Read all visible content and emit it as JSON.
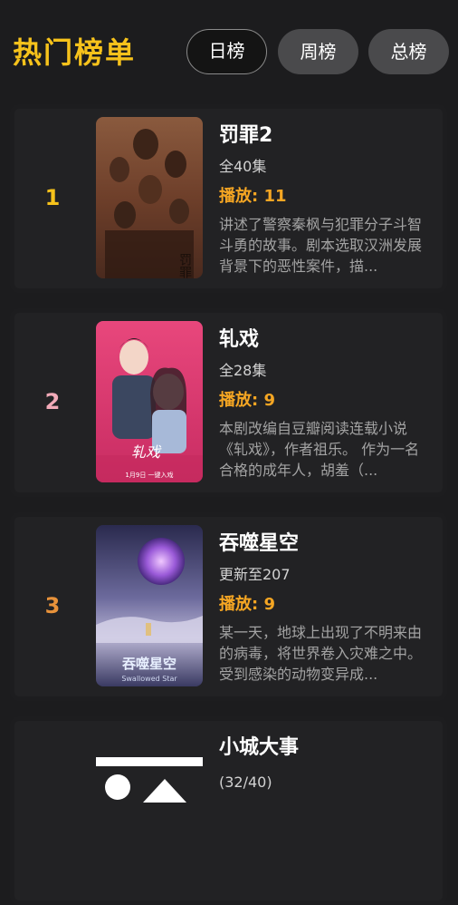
{
  "header": {
    "title": "热门榜单",
    "tabs": [
      {
        "label": "日榜",
        "active": true
      },
      {
        "label": "周榜",
        "active": false
      },
      {
        "label": "总榜",
        "active": false
      }
    ]
  },
  "colors": {
    "title": "#f6c21b",
    "plays": "#f5a623",
    "rank1": "#f6c21b",
    "rank2": "#f2aab8",
    "rank3": "#e8923a"
  },
  "items": [
    {
      "rank": "1",
      "name": "罚罪2",
      "episodes": "全40集",
      "plays": "播放: 11",
      "description": "讲述了警察秦枫与犯罪分子斗智斗勇的故事。剧本选取汉洲发展背景下的恶性案件，描...",
      "poster_text": "罚罪"
    },
    {
      "rank": "2",
      "name": "轧戏",
      "episodes": "全28集",
      "plays": "播放: 9",
      "description": "本剧改编自豆瓣阅读连载小说《轧戏》，作者祖乐。 作为一名合格的成年人，胡羞（...",
      "poster_text": "轧戏",
      "poster_caption": "1月9日 一键入戏"
    },
    {
      "rank": "3",
      "name": "吞噬星空",
      "episodes": "更新至207",
      "plays": "播放: 9",
      "description": "某一天，地球上出现了不明来由的病毒，将世界卷入灾难之中。受到感染的动物变异成...",
      "poster_text": "吞噬星空",
      "poster_caption": "Swallowed Star"
    },
    {
      "rank": "",
      "name": "小城大事",
      "episodes": "(32/40)",
      "plays": "",
      "description": ""
    }
  ]
}
